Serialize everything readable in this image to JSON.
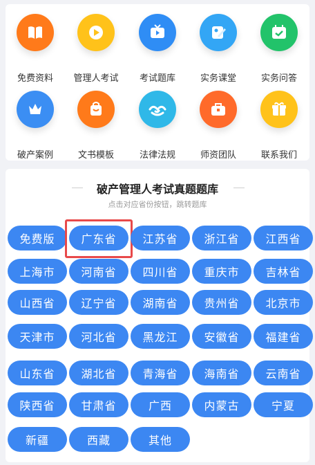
{
  "categories": [
    {
      "label": "免费资料",
      "icon": "book-icon",
      "color": "#ff7a1a"
    },
    {
      "label": "管理人考试",
      "icon": "play-icon",
      "color": "#ffc21a"
    },
    {
      "label": "考试题库",
      "icon": "tv-icon",
      "color": "#2f8df5"
    },
    {
      "label": "实务课堂",
      "icon": "pencil-board-icon",
      "color": "#33a6f5"
    },
    {
      "label": "实务问答",
      "icon": "calendar-check-icon",
      "color": "#22c36a"
    },
    {
      "label": "破产案例",
      "icon": "crown-icon",
      "color": "#3b8ef3"
    },
    {
      "label": "文书模板",
      "icon": "bag-icon",
      "color": "#ff7a1a"
    },
    {
      "label": "法律法规",
      "icon": "handshake-icon",
      "color": "#2fb8e8"
    },
    {
      "label": "师资团队",
      "icon": "briefcase-icon",
      "color": "#ff6a2a"
    },
    {
      "label": "联系我们",
      "icon": "gift-icon",
      "color": "#ffc21a"
    }
  ],
  "section": {
    "title": "破产管理人考试真题题库",
    "subtitle": "点击对应省份按钮，跳转题库"
  },
  "provinces": [
    "免费版",
    "广东省",
    "江苏省",
    "浙江省",
    "江西省",
    "上海市",
    "河南省",
    "四川省",
    "重庆市",
    "吉林省",
    "山西省",
    "辽宁省",
    "湖南省",
    "贵州省",
    "北京市",
    "天津市",
    "河北省",
    "黑龙江",
    "安徽省",
    "福建省",
    "山东省",
    "湖北省",
    "青海省",
    "海南省",
    "云南省",
    "陕西省",
    "甘肃省",
    "广西",
    "内蒙古",
    "宁夏",
    "新疆",
    "西藏",
    "其他"
  ],
  "highlighted": "广东省",
  "colors": {
    "button": "#3c87f2",
    "highlight": "#e8494a"
  }
}
